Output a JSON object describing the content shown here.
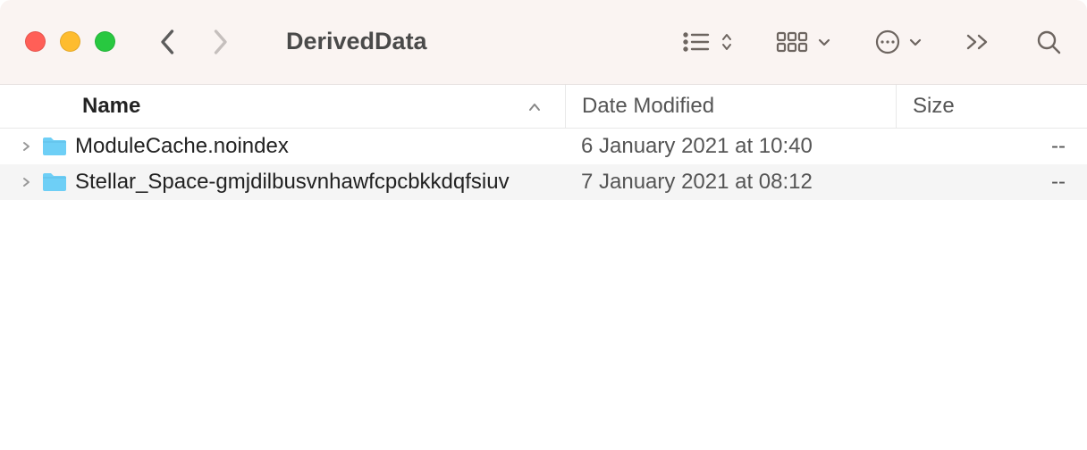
{
  "window": {
    "title": "DerivedData"
  },
  "columns": {
    "name": "Name",
    "date": "Date Modified",
    "size": "Size"
  },
  "rows": [
    {
      "name": "ModuleCache.noindex",
      "date": "6 January 2021 at 10:40",
      "size": "--"
    },
    {
      "name": "Stellar_Space-gmjdilbusvnhawfcpcbkkdqfsiuv",
      "date": "7 January 2021 at 08:12",
      "size": "--"
    }
  ]
}
